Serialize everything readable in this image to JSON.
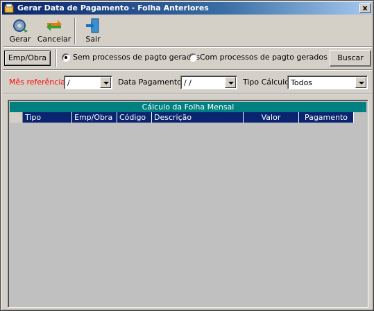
{
  "window": {
    "title": "Gerar Data de Pagamento - Folha Anteriores",
    "close_label": "x"
  },
  "toolbar": {
    "gerar_label": "Gerar",
    "cancelar_label": "Cancelar",
    "sair_label": "Sair"
  },
  "filters": {
    "emp_obra_button": "Emp/Obra",
    "radio_sem": "Sem processos de pagto gerados",
    "radio_com": "Com processos de pagto gerados",
    "radio_selected": "sem",
    "buscar_button": "Buscar",
    "mes_referencia_label": "Mês referência:",
    "mes_referencia_value": "/",
    "data_pagamento_label": "Data Pagamento:",
    "data_pagamento_value": "/  /",
    "tipo_calculo_label": "Tipo Cálculo:",
    "tipo_calculo_value": "Todos"
  },
  "grid": {
    "band_title": "Cálculo da Folha Mensal",
    "columns": [
      "Tipo",
      "Emp/Obra",
      "Código",
      "Descrição",
      "Valor",
      "Pagamento"
    ],
    "rows": []
  },
  "colors": {
    "title_gradient_start": "#0a246a",
    "band_teal": "#008080",
    "header_navy": "#0a2470",
    "mes_label_red": "#ff0000"
  },
  "icons": {
    "app": "folder-calendar-icon",
    "gerar": "gear-refresh-icon",
    "cancelar": "swap-arrows-icon",
    "sair": "exit-door-icon"
  }
}
